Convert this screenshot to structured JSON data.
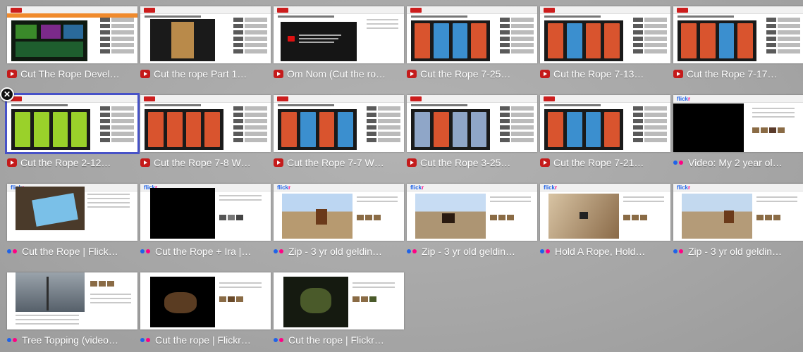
{
  "tiles": [
    {
      "label": "Cut The Rope Devel…",
      "source": "youtube"
    },
    {
      "label": "Cut the rope Part 1…",
      "source": "youtube"
    },
    {
      "label": "Om Nom (Cut the ro…",
      "source": "youtube"
    },
    {
      "label": "Cut the Rope 7-25…",
      "source": "youtube"
    },
    {
      "label": "Cut the Rope 7-13…",
      "source": "youtube"
    },
    {
      "label": "Cut the Rope 7-17…",
      "source": "youtube"
    },
    {
      "label": "Cut the Rope 2-12…",
      "source": "youtube",
      "selected": true
    },
    {
      "label": "Cut the Rope 7-8 W…",
      "source": "youtube"
    },
    {
      "label": "Cut the Rope 7-7 W…",
      "source": "youtube"
    },
    {
      "label": "Cut the Rope 3-25…",
      "source": "youtube"
    },
    {
      "label": "Cut the Rope 7-21…",
      "source": "youtube"
    },
    {
      "label": "Video: My 2 year ol…",
      "source": "flickr"
    },
    {
      "label": "Cut the Rope | Flick…",
      "source": "flickr"
    },
    {
      "label": "Cut the Rope + Ira |…",
      "source": "flickr"
    },
    {
      "label": "Zip - 3 yr old geldin…",
      "source": "flickr"
    },
    {
      "label": "Zip - 3 yr old geldin…",
      "source": "flickr"
    },
    {
      "label": "Hold A Rope, Hold…",
      "source": "flickr"
    },
    {
      "label": "Zip - 3 yr old geldin…",
      "source": "flickr"
    },
    {
      "label": "Tree Topping (video…",
      "source": "flickr"
    },
    {
      "label": "Cut the rope | Flickr…",
      "source": "flickr"
    },
    {
      "label": "Cut the rope | Flickr…",
      "source": "flickr"
    }
  ],
  "close_glyph": "✕",
  "colors": {
    "selection": "#4752c8",
    "youtube": "#c41b1b",
    "flickr_blue": "#1f63e8",
    "flickr_pink": "#ff0084"
  }
}
